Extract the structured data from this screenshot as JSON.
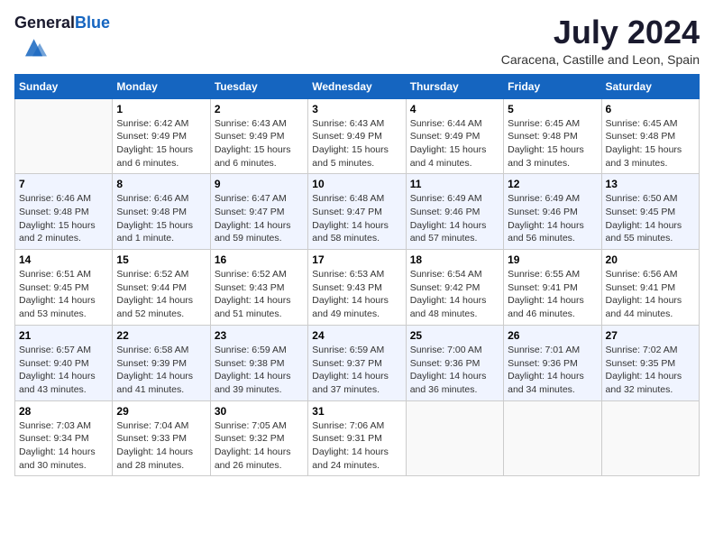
{
  "header": {
    "logo_general": "General",
    "logo_blue": "Blue",
    "month_title": "July 2024",
    "location": "Caracena, Castille and Leon, Spain"
  },
  "weekdays": [
    "Sunday",
    "Monday",
    "Tuesday",
    "Wednesday",
    "Thursday",
    "Friday",
    "Saturday"
  ],
  "weeks": [
    [
      {
        "day": "",
        "sunrise": "",
        "sunset": "",
        "daylight": ""
      },
      {
        "day": "1",
        "sunrise": "Sunrise: 6:42 AM",
        "sunset": "Sunset: 9:49 PM",
        "daylight": "Daylight: 15 hours and 6 minutes."
      },
      {
        "day": "2",
        "sunrise": "Sunrise: 6:43 AM",
        "sunset": "Sunset: 9:49 PM",
        "daylight": "Daylight: 15 hours and 6 minutes."
      },
      {
        "day": "3",
        "sunrise": "Sunrise: 6:43 AM",
        "sunset": "Sunset: 9:49 PM",
        "daylight": "Daylight: 15 hours and 5 minutes."
      },
      {
        "day": "4",
        "sunrise": "Sunrise: 6:44 AM",
        "sunset": "Sunset: 9:49 PM",
        "daylight": "Daylight: 15 hours and 4 minutes."
      },
      {
        "day": "5",
        "sunrise": "Sunrise: 6:45 AM",
        "sunset": "Sunset: 9:48 PM",
        "daylight": "Daylight: 15 hours and 3 minutes."
      },
      {
        "day": "6",
        "sunrise": "Sunrise: 6:45 AM",
        "sunset": "Sunset: 9:48 PM",
        "daylight": "Daylight: 15 hours and 3 minutes."
      }
    ],
    [
      {
        "day": "7",
        "sunrise": "Sunrise: 6:46 AM",
        "sunset": "Sunset: 9:48 PM",
        "daylight": "Daylight: 15 hours and 2 minutes."
      },
      {
        "day": "8",
        "sunrise": "Sunrise: 6:46 AM",
        "sunset": "Sunset: 9:48 PM",
        "daylight": "Daylight: 15 hours and 1 minute."
      },
      {
        "day": "9",
        "sunrise": "Sunrise: 6:47 AM",
        "sunset": "Sunset: 9:47 PM",
        "daylight": "Daylight: 14 hours and 59 minutes."
      },
      {
        "day": "10",
        "sunrise": "Sunrise: 6:48 AM",
        "sunset": "Sunset: 9:47 PM",
        "daylight": "Daylight: 14 hours and 58 minutes."
      },
      {
        "day": "11",
        "sunrise": "Sunrise: 6:49 AM",
        "sunset": "Sunset: 9:46 PM",
        "daylight": "Daylight: 14 hours and 57 minutes."
      },
      {
        "day": "12",
        "sunrise": "Sunrise: 6:49 AM",
        "sunset": "Sunset: 9:46 PM",
        "daylight": "Daylight: 14 hours and 56 minutes."
      },
      {
        "day": "13",
        "sunrise": "Sunrise: 6:50 AM",
        "sunset": "Sunset: 9:45 PM",
        "daylight": "Daylight: 14 hours and 55 minutes."
      }
    ],
    [
      {
        "day": "14",
        "sunrise": "Sunrise: 6:51 AM",
        "sunset": "Sunset: 9:45 PM",
        "daylight": "Daylight: 14 hours and 53 minutes."
      },
      {
        "day": "15",
        "sunrise": "Sunrise: 6:52 AM",
        "sunset": "Sunset: 9:44 PM",
        "daylight": "Daylight: 14 hours and 52 minutes."
      },
      {
        "day": "16",
        "sunrise": "Sunrise: 6:52 AM",
        "sunset": "Sunset: 9:43 PM",
        "daylight": "Daylight: 14 hours and 51 minutes."
      },
      {
        "day": "17",
        "sunrise": "Sunrise: 6:53 AM",
        "sunset": "Sunset: 9:43 PM",
        "daylight": "Daylight: 14 hours and 49 minutes."
      },
      {
        "day": "18",
        "sunrise": "Sunrise: 6:54 AM",
        "sunset": "Sunset: 9:42 PM",
        "daylight": "Daylight: 14 hours and 48 minutes."
      },
      {
        "day": "19",
        "sunrise": "Sunrise: 6:55 AM",
        "sunset": "Sunset: 9:41 PM",
        "daylight": "Daylight: 14 hours and 46 minutes."
      },
      {
        "day": "20",
        "sunrise": "Sunrise: 6:56 AM",
        "sunset": "Sunset: 9:41 PM",
        "daylight": "Daylight: 14 hours and 44 minutes."
      }
    ],
    [
      {
        "day": "21",
        "sunrise": "Sunrise: 6:57 AM",
        "sunset": "Sunset: 9:40 PM",
        "daylight": "Daylight: 14 hours and 43 minutes."
      },
      {
        "day": "22",
        "sunrise": "Sunrise: 6:58 AM",
        "sunset": "Sunset: 9:39 PM",
        "daylight": "Daylight: 14 hours and 41 minutes."
      },
      {
        "day": "23",
        "sunrise": "Sunrise: 6:59 AM",
        "sunset": "Sunset: 9:38 PM",
        "daylight": "Daylight: 14 hours and 39 minutes."
      },
      {
        "day": "24",
        "sunrise": "Sunrise: 6:59 AM",
        "sunset": "Sunset: 9:37 PM",
        "daylight": "Daylight: 14 hours and 37 minutes."
      },
      {
        "day": "25",
        "sunrise": "Sunrise: 7:00 AM",
        "sunset": "Sunset: 9:36 PM",
        "daylight": "Daylight: 14 hours and 36 minutes."
      },
      {
        "day": "26",
        "sunrise": "Sunrise: 7:01 AM",
        "sunset": "Sunset: 9:36 PM",
        "daylight": "Daylight: 14 hours and 34 minutes."
      },
      {
        "day": "27",
        "sunrise": "Sunrise: 7:02 AM",
        "sunset": "Sunset: 9:35 PM",
        "daylight": "Daylight: 14 hours and 32 minutes."
      }
    ],
    [
      {
        "day": "28",
        "sunrise": "Sunrise: 7:03 AM",
        "sunset": "Sunset: 9:34 PM",
        "daylight": "Daylight: 14 hours and 30 minutes."
      },
      {
        "day": "29",
        "sunrise": "Sunrise: 7:04 AM",
        "sunset": "Sunset: 9:33 PM",
        "daylight": "Daylight: 14 hours and 28 minutes."
      },
      {
        "day": "30",
        "sunrise": "Sunrise: 7:05 AM",
        "sunset": "Sunset: 9:32 PM",
        "daylight": "Daylight: 14 hours and 26 minutes."
      },
      {
        "day": "31",
        "sunrise": "Sunrise: 7:06 AM",
        "sunset": "Sunset: 9:31 PM",
        "daylight": "Daylight: 14 hours and 24 minutes."
      },
      {
        "day": "",
        "sunrise": "",
        "sunset": "",
        "daylight": ""
      },
      {
        "day": "",
        "sunrise": "",
        "sunset": "",
        "daylight": ""
      },
      {
        "day": "",
        "sunrise": "",
        "sunset": "",
        "daylight": ""
      }
    ]
  ]
}
